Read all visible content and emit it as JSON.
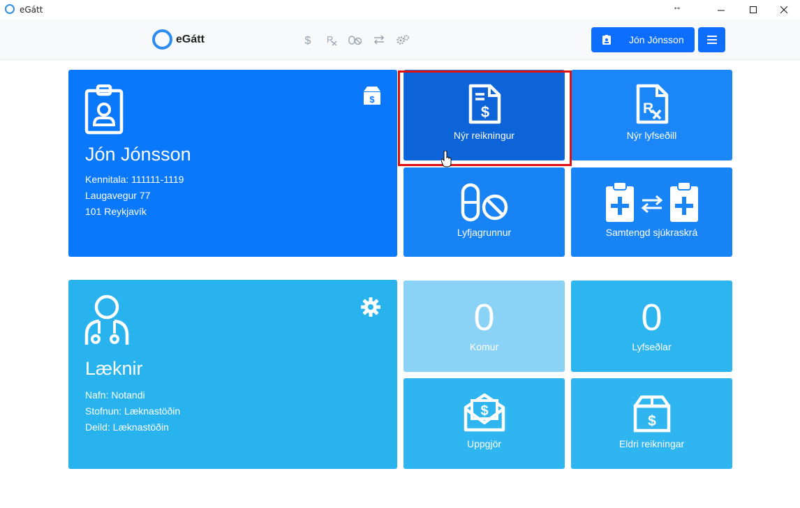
{
  "window": {
    "title": "eGátt"
  },
  "header": {
    "logo_text": "eGátt",
    "nav": [
      {
        "icon": "dollar-icon"
      },
      {
        "icon": "prescription-icon"
      },
      {
        "icon": "pill-block-icon"
      },
      {
        "icon": "exchange-icon"
      },
      {
        "icon": "cogs-icon"
      }
    ],
    "user_label": "Jón Jónsson"
  },
  "patient": {
    "name": "Jón Jónsson",
    "kennitala": "Kennitala: 111111-1119",
    "address": "Laugavegur 77",
    "city": "101 Reykjavík"
  },
  "doctor": {
    "title": "Læknir",
    "nafn": "Nafn: Notandi",
    "stofnun": "Stofnun: Læknastöðin",
    "deild": "Deild: Læknastöðin"
  },
  "tiles": {
    "new_invoice": "Nýr reikningur",
    "new_prescription": "Nýr lyfseðill",
    "drug_base": "Lyfjagrunnur",
    "shared_record": "Samtengd sjúkraskrá",
    "visits_count": "0",
    "visits_label": "Komur",
    "prescriptions_count": "0",
    "prescriptions_label": "Lyfseðlar",
    "settlement": "Uppgjör",
    "old_invoices": "Eldri reikningar"
  },
  "colors": {
    "primary": "#0d6efd",
    "patient_card": "#0a78fb",
    "doctor_card": "#28b3ee",
    "highlight": "#e11010"
  }
}
